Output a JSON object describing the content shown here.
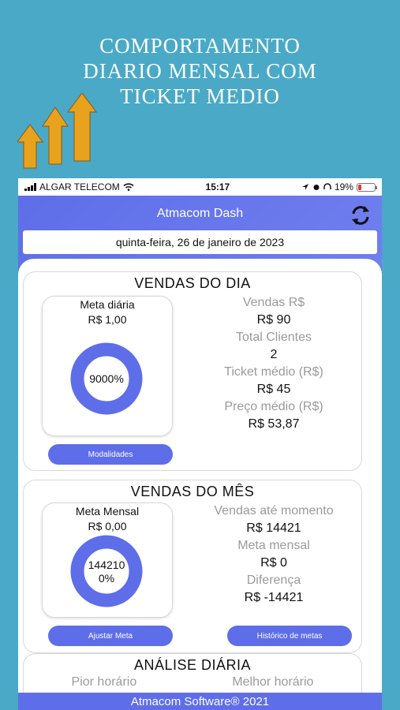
{
  "headline": [
    "COMPORTAMENTO",
    "DIARIO MENSAL COM",
    "TICKET MEDIO"
  ],
  "status": {
    "carrier": "ALGAR TELECOM",
    "time": "15:17",
    "battery": "19%"
  },
  "app": {
    "title": "Atmacom Dash",
    "date": "quinta-feira, 26 de janeiro de 2023"
  },
  "daily": {
    "title": "VENDAS DO DIA",
    "meta_label": "Meta diária",
    "meta_value": "R$ 1,00",
    "donut_text": "9000%",
    "stats": [
      {
        "label": "Vendas R$",
        "value": "R$ 90"
      },
      {
        "label": "Total Clientes",
        "value": "2"
      },
      {
        "label": "Ticket médio (R$)",
        "value": "R$ 45"
      },
      {
        "label": "Preço médio (R$)",
        "value": "R$ 53,87"
      }
    ],
    "button": "Modalidades"
  },
  "monthly": {
    "title": "VENDAS DO MÊS",
    "meta_label": "Meta Mensal",
    "meta_value": "R$ 0,00",
    "donut_line1": "144210",
    "donut_line2": "0%",
    "stats": [
      {
        "label": "Vendas até momento",
        "value": "R$ 14421"
      },
      {
        "label": "Meta mensal",
        "value": "R$ 0"
      },
      {
        "label": "Diferença",
        "value": "R$ -14421"
      }
    ],
    "button_left": "Ajustar Meta",
    "button_right": "Histórico de metas"
  },
  "analysis": {
    "title": "ANÁLISE DIÁRIA",
    "worst": "Pior horário",
    "best": "Melhor horário"
  },
  "footer": "Atmacom Software® 2021",
  "colors": {
    "accent": "#5e6ee8",
    "background": "#4aa9c6",
    "arrow": "#e8a21e"
  },
  "icons": [
    "wifi-icon",
    "location-icon",
    "alarm-icon",
    "headphones-icon",
    "battery-icon",
    "refresh-icon",
    "growth-arrows-icon"
  ]
}
